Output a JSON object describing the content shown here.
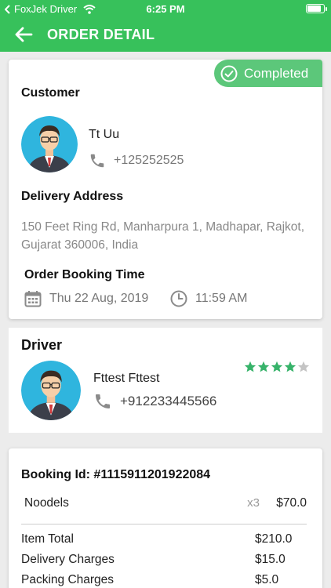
{
  "status_bar": {
    "app_back_label": "FoxJek Driver",
    "time": "6:25 PM",
    "battery_level": 0.92
  },
  "header": {
    "title": "ORDER DETAIL"
  },
  "order_card": {
    "status_badge": "Completed",
    "customer_heading": "Customer",
    "customer_name": "Tt Uu",
    "customer_phone": "+125252525",
    "address_heading": "Delivery Address",
    "address": "150 Feet Ring Rd, Manharpura 1, Madhapar, Rajkot, Gujarat 360006, India",
    "booking_time_heading": "Order Booking Time",
    "booking_date": "Thu 22 Aug, 2019",
    "booking_time": "11:59 AM"
  },
  "driver_card": {
    "heading": "Driver",
    "name": "Fttest Fttest",
    "phone": "+912233445566",
    "rating": 4,
    "rating_max": 5
  },
  "booking_card": {
    "booking_id": "Booking Id: #1115911201922084",
    "items": [
      {
        "name": "Noodels",
        "qty": "x3",
        "amount": "$70.0"
      }
    ],
    "summary": [
      {
        "label": "Item Total",
        "amount": "$210.0"
      },
      {
        "label": "Delivery Charges",
        "amount": "$15.0"
      },
      {
        "label": "Packing Charges",
        "amount": "$5.0"
      }
    ]
  },
  "colors": {
    "primary_green": "#37c15b",
    "badge_green": "#5cc77a",
    "star_green": "#37b36a",
    "star_empty": "#c4c4c4"
  }
}
